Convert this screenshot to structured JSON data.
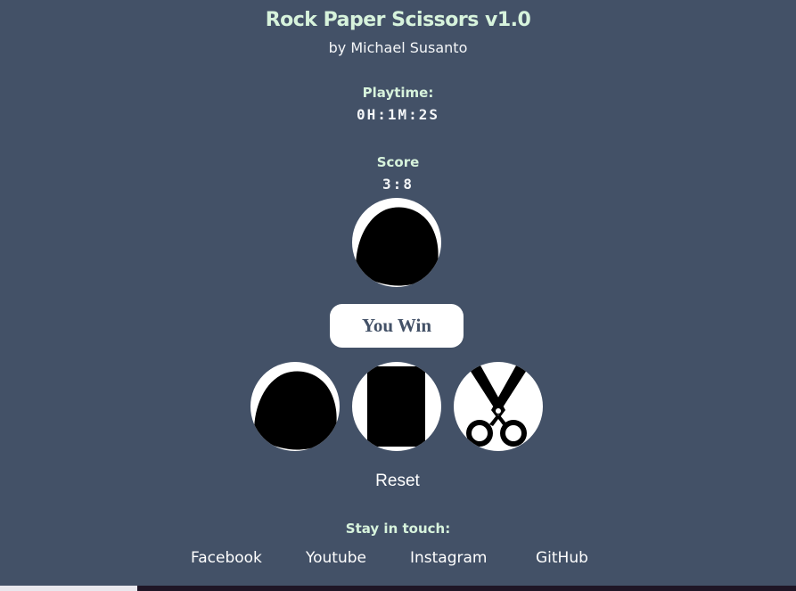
{
  "header": {
    "title": "Rock Paper Scissors v1.0",
    "byline": "by Michael Susanto"
  },
  "playtime": {
    "label": "Playtime:",
    "value": "0H:1M:2S"
  },
  "score": {
    "label": "Score",
    "value": "3:8"
  },
  "computer_choice": {
    "icon": "rock-icon"
  },
  "result": {
    "text": "You Win"
  },
  "choices": [
    {
      "icon": "rock-icon"
    },
    {
      "icon": "paper-icon"
    },
    {
      "icon": "scissors-icon"
    }
  ],
  "reset": {
    "label": "Reset"
  },
  "footer": {
    "stay_label": "Stay in touch:",
    "links": [
      {
        "label": "Facebook"
      },
      {
        "label": "Youtube"
      },
      {
        "label": "Instagram"
      },
      {
        "label": "GitHub"
      }
    ]
  },
  "colors": {
    "background": "#435167",
    "accent": "#d7f3dc",
    "text": "#ffffff"
  }
}
